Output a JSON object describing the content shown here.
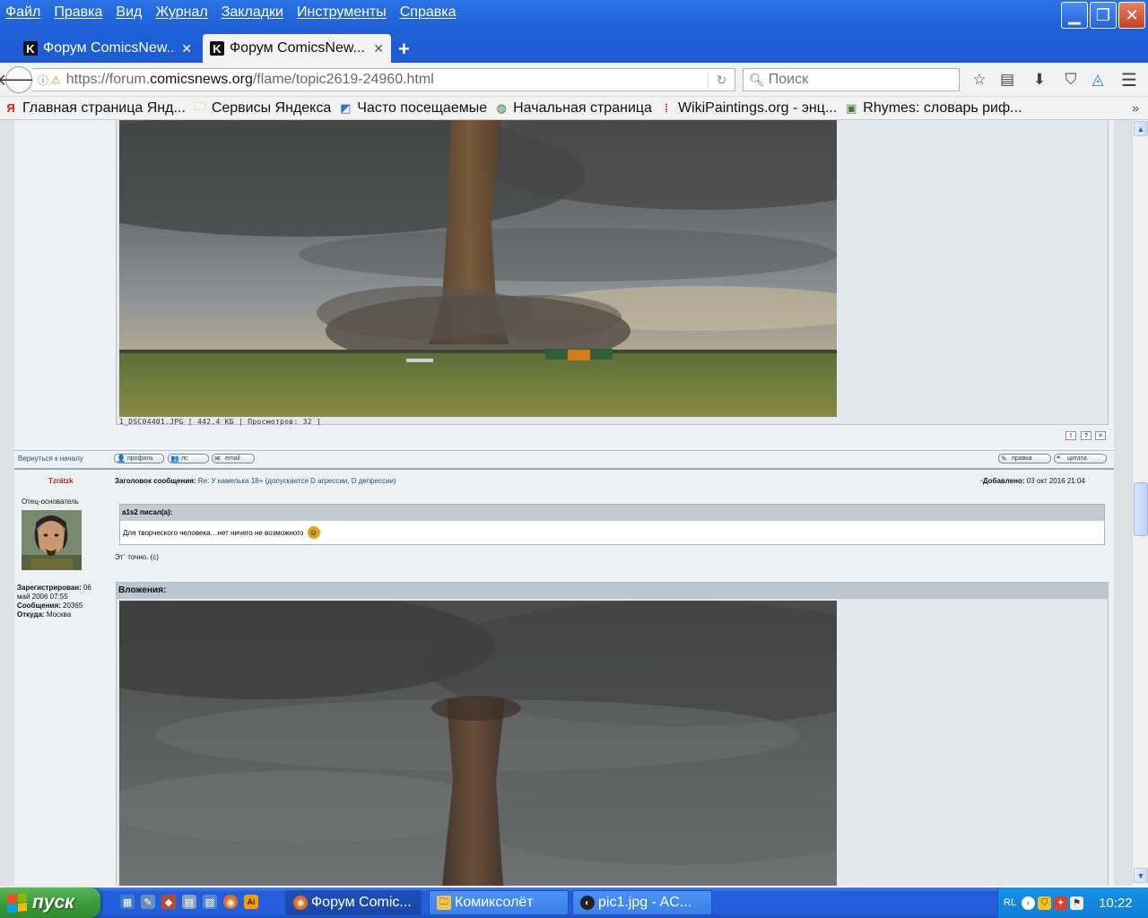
{
  "menu": [
    "Файл",
    "Правка",
    "Вид",
    "Журнал",
    "Закладки",
    "Инструменты",
    "Справка"
  ],
  "tabs": [
    {
      "favicon": "K",
      "label": "Форум ComicsNew..."
    },
    {
      "favicon": "K",
      "label": "Форум ComicsNew..."
    }
  ],
  "nav": {
    "url_prefix": "https://forum.",
    "url_domain": "comicsnews.org",
    "url_path": "/flame/topic2619-24960.html",
    "search_placeholder": "Поиск"
  },
  "bookmarks": [
    {
      "icon": "yandex-icon",
      "label": "Главная страница Янд..."
    },
    {
      "icon": "folder-icon",
      "label": "Сервисы Яндекса"
    },
    {
      "icon": "most-visited-icon",
      "label": "Часто посещаемые"
    },
    {
      "icon": "globe-icon",
      "label": "Начальная страница"
    },
    {
      "icon": "wikipaintings-icon",
      "label": "WikiPaintings.org - энц..."
    },
    {
      "icon": "book-icon",
      "label": "Rhymes: словарь риф..."
    }
  ],
  "post1": {
    "caption": "1_DSC04401.JPG [ 442.4 КБ | Просмотров: 32 ]",
    "back_to_top": "Вернуться к началу",
    "btn_profile": "профиль",
    "btn_pm": "лс",
    "btn_email": "email",
    "btn_edit": "правка",
    "btn_quote": "цитата"
  },
  "post2": {
    "author": "Tzrätzk",
    "rank": "Отец-основатель",
    "subject_label": "Заголовок сообщения:",
    "subject": "Re: У камелька 18+ (допускается D агрессии, D депрессии)",
    "posted_label": "Добавлено:",
    "posted": "03 окт 2016 21:04",
    "quote_author": "a1s2 писал(а):",
    "quote_text": "Для творческого человека…нет ничего не возможного",
    "body": "Эт´ точно. (с)",
    "reg_label": "Зарегистрирован:",
    "reg_value": "06",
    "reg_value2": "май 2006 07:55",
    "posts_label": "Сообщения:",
    "posts_value": "20365",
    "from_label": "Откуда:",
    "from_value": "Москва",
    "attachments_label": "Вложения:"
  },
  "taskbar": {
    "start": "пуск",
    "tasks": [
      {
        "icon": "firefox-icon",
        "label": "Форум Comic..."
      },
      {
        "icon": "folder-icon",
        "label": "Комиксолёт"
      },
      {
        "icon": "acdsee-icon",
        "label": "pic1.jpg - AC..."
      }
    ],
    "lang": "RL",
    "clock": "10:22"
  }
}
